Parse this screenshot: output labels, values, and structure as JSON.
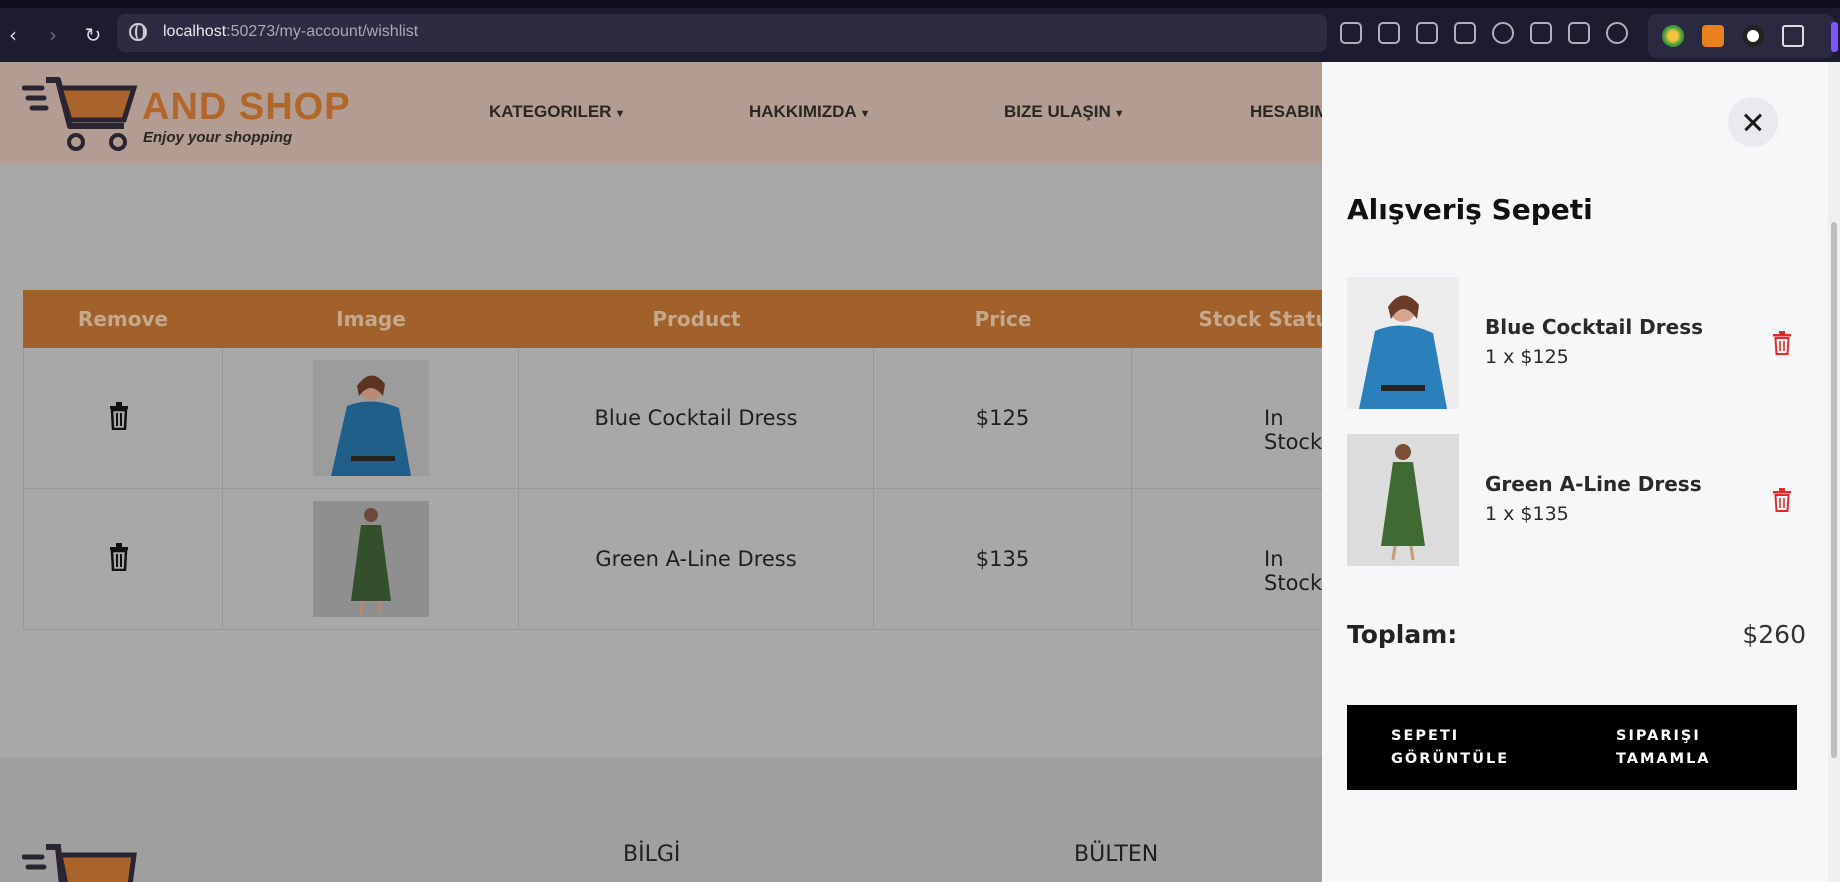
{
  "browser": {
    "url_host": "localhost",
    "url_rest": ":50273/my-account/wishlist"
  },
  "site": {
    "logo_text": "AND SHOP",
    "logo_tagline": "Enjoy your shopping",
    "menu": [
      {
        "label": "KATEGORILER"
      },
      {
        "label": "HAKKIMIZDA"
      },
      {
        "label": "BIZE ULAŞIN"
      },
      {
        "label": "HESABIM"
      }
    ]
  },
  "wishlist": {
    "headers": [
      "Remove",
      "Image",
      "Product",
      "Price",
      "Stock Status"
    ],
    "rows": [
      {
        "product": "Blue Cocktail Dress",
        "price": "$125",
        "stock": "In Stock",
        "image": "woman-blue-dress"
      },
      {
        "product": "Green A-Line Dress",
        "price": "$135",
        "stock": "In Stock",
        "image": "woman-green-dress"
      }
    ]
  },
  "footer": {
    "titles": [
      "BİLGİ",
      "BÜLTEN"
    ]
  },
  "cart": {
    "title": "Alışveriş Sepeti",
    "items": [
      {
        "name": "Blue Cocktail Dress",
        "qty_price": "1 x $125"
      },
      {
        "name": "Green A-Line Dress",
        "qty_price": "1 x $135"
      }
    ],
    "total_label": "Toplam:",
    "total_value": "$260",
    "view_cart_label": "SEPETI GÖRÜNTÜLE",
    "checkout_label": "SIPARIŞI TAMAMLA"
  },
  "colors": {
    "header_accent": "#a2602b",
    "delete_red": "#e02b2b",
    "logo_orange": "#b2672a"
  }
}
